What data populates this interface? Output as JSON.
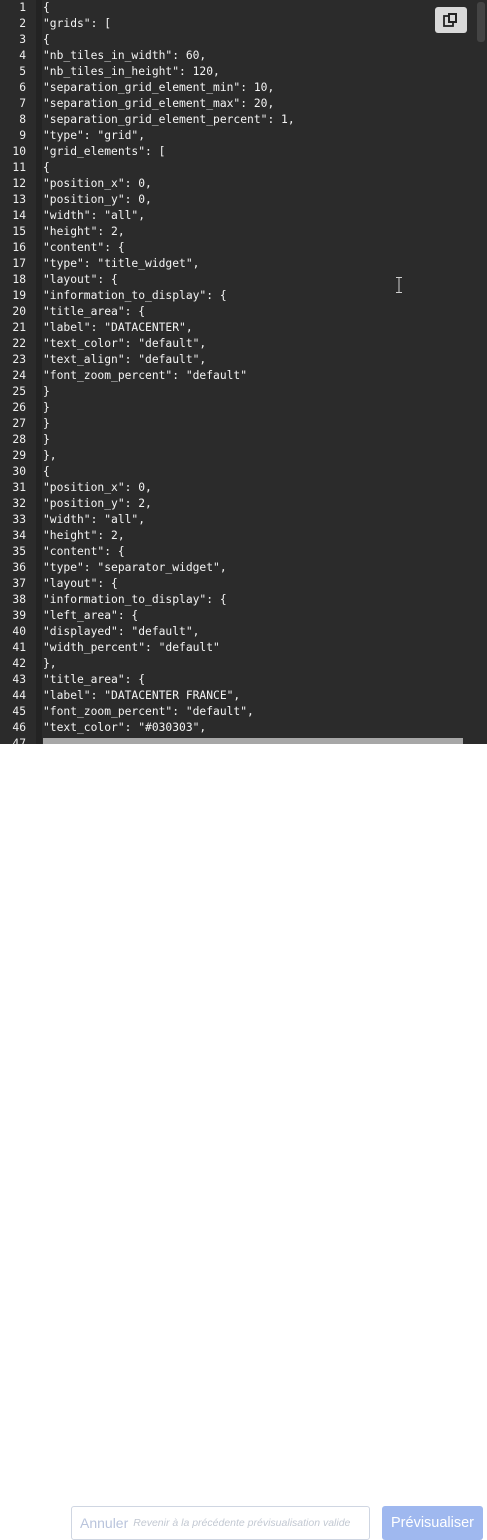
{
  "editor": {
    "lines": [
      {
        "n": "1",
        "t": "{"
      },
      {
        "n": "2",
        "t": "\"grids\": ["
      },
      {
        "n": "3",
        "t": "{"
      },
      {
        "n": "4",
        "t": "\"nb_tiles_in_width\": 60,"
      },
      {
        "n": "5",
        "t": "\"nb_tiles_in_height\": 120,"
      },
      {
        "n": "6",
        "t": "\"separation_grid_element_min\": 10,"
      },
      {
        "n": "7",
        "t": "\"separation_grid_element_max\": 20,"
      },
      {
        "n": "8",
        "t": "\"separation_grid_element_percent\": 1,"
      },
      {
        "n": "9",
        "t": "\"type\": \"grid\","
      },
      {
        "n": "10",
        "t": "\"grid_elements\": ["
      },
      {
        "n": "11",
        "t": "{"
      },
      {
        "n": "12",
        "t": "\"position_x\": 0,"
      },
      {
        "n": "13",
        "t": "\"position_y\": 0,"
      },
      {
        "n": "14",
        "t": "\"width\": \"all\","
      },
      {
        "n": "15",
        "t": "\"height\": 2,"
      },
      {
        "n": "16",
        "t": "\"content\": {"
      },
      {
        "n": "17",
        "t": "\"type\": \"title_widget\","
      },
      {
        "n": "18",
        "t": "\"layout\": {"
      },
      {
        "n": "19",
        "t": "\"information_to_display\": {"
      },
      {
        "n": "20",
        "t": "\"title_area\": {"
      },
      {
        "n": "21",
        "t": "\"label\": \"DATACENTER\","
      },
      {
        "n": "22",
        "t": "\"text_color\": \"default\","
      },
      {
        "n": "23",
        "t": "\"text_align\": \"default\","
      },
      {
        "n": "24",
        "t": "\"font_zoom_percent\": \"default\""
      },
      {
        "n": "25",
        "t": "}"
      },
      {
        "n": "26",
        "t": "}"
      },
      {
        "n": "27",
        "t": "}"
      },
      {
        "n": "28",
        "t": "}"
      },
      {
        "n": "29",
        "t": "},"
      },
      {
        "n": "30",
        "t": "{"
      },
      {
        "n": "31",
        "t": "\"position_x\": 0,"
      },
      {
        "n": "32",
        "t": "\"position_y\": 2,"
      },
      {
        "n": "33",
        "t": "\"width\": \"all\","
      },
      {
        "n": "34",
        "t": "\"height\": 2,"
      },
      {
        "n": "35",
        "t": "\"content\": {"
      },
      {
        "n": "36",
        "t": "\"type\": \"separator_widget\","
      },
      {
        "n": "37",
        "t": "\"layout\": {"
      },
      {
        "n": "38",
        "t": "\"information_to_display\": {"
      },
      {
        "n": "39",
        "t": "\"left_area\": {"
      },
      {
        "n": "40",
        "t": "\"displayed\": \"default\","
      },
      {
        "n": "41",
        "t": "\"width_percent\": \"default\""
      },
      {
        "n": "42",
        "t": "},"
      },
      {
        "n": "43",
        "t": "\"title_area\": {"
      },
      {
        "n": "44",
        "t": "\"label\": \"DATACENTER FRANCE\","
      },
      {
        "n": "45",
        "t": "\"font_zoom_percent\": \"default\","
      },
      {
        "n": "46",
        "t": "\"text_color\": \"#030303\","
      },
      {
        "n": "47",
        "t": ""
      }
    ],
    "copy_icon": "copy-icon",
    "colors": {
      "background": "#2b2b2b",
      "text": "#f4f4f4"
    }
  },
  "footer": {
    "cancel_label": "Annuler",
    "input_placeholder": "Revenir à la précédente prévisualisation valide",
    "preview_label": "Prévisualiser",
    "colors": {
      "preview_button": "#9fb8ef",
      "cancel_text": "#b9c4dc"
    }
  }
}
